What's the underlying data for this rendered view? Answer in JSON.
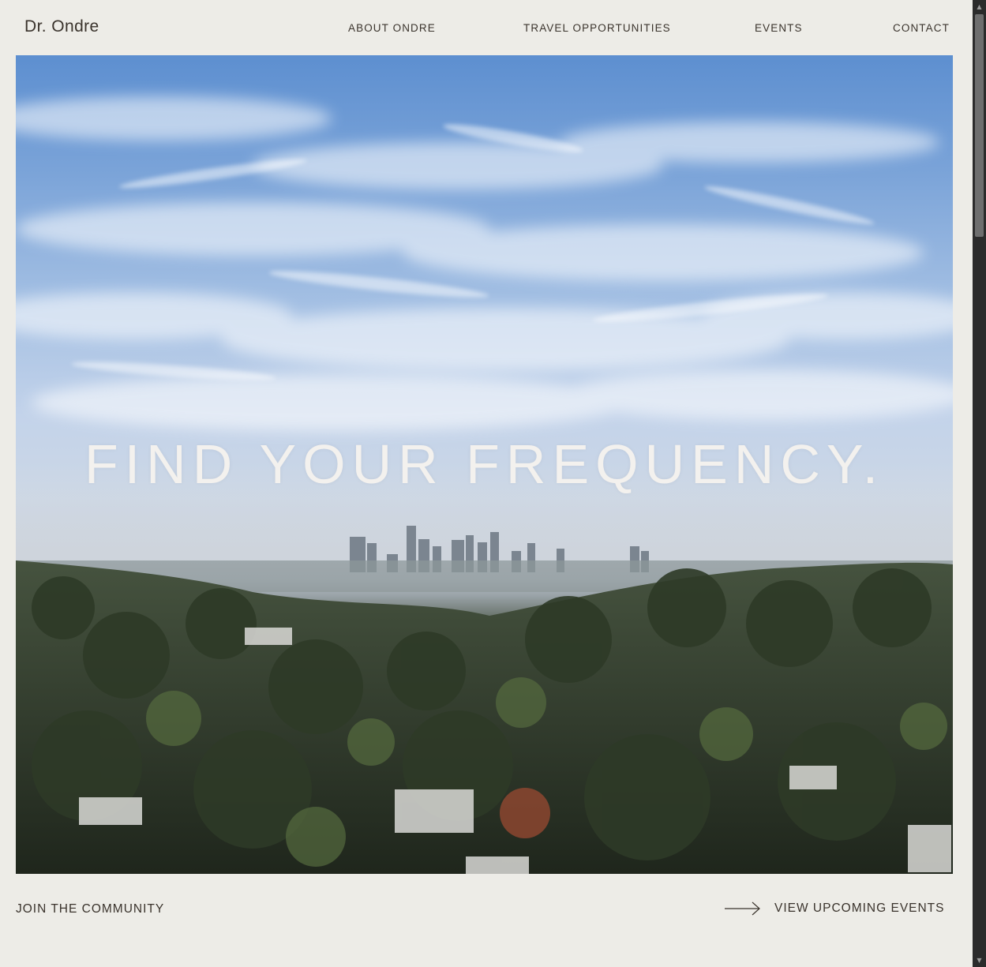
{
  "header": {
    "logo": "Dr. Ondre",
    "nav": {
      "about": "ABOUT ONDRE",
      "travel": "TRAVEL OPPORTUNITIES",
      "events": "EVENTS",
      "contact": "CONTACT"
    }
  },
  "hero": {
    "title": "FIND YOUR FREQUENCY.",
    "media": "aerial city skyline video"
  },
  "footer": {
    "join_label": "JOIN THE COMMUNITY",
    "events_label": "VIEW UPCOMING EVENTS",
    "arrow_icon": "arrow-right-icon"
  },
  "colors": {
    "background": "#edece7",
    "text": "#3a332c",
    "hero_text": "#f3f1ee"
  }
}
